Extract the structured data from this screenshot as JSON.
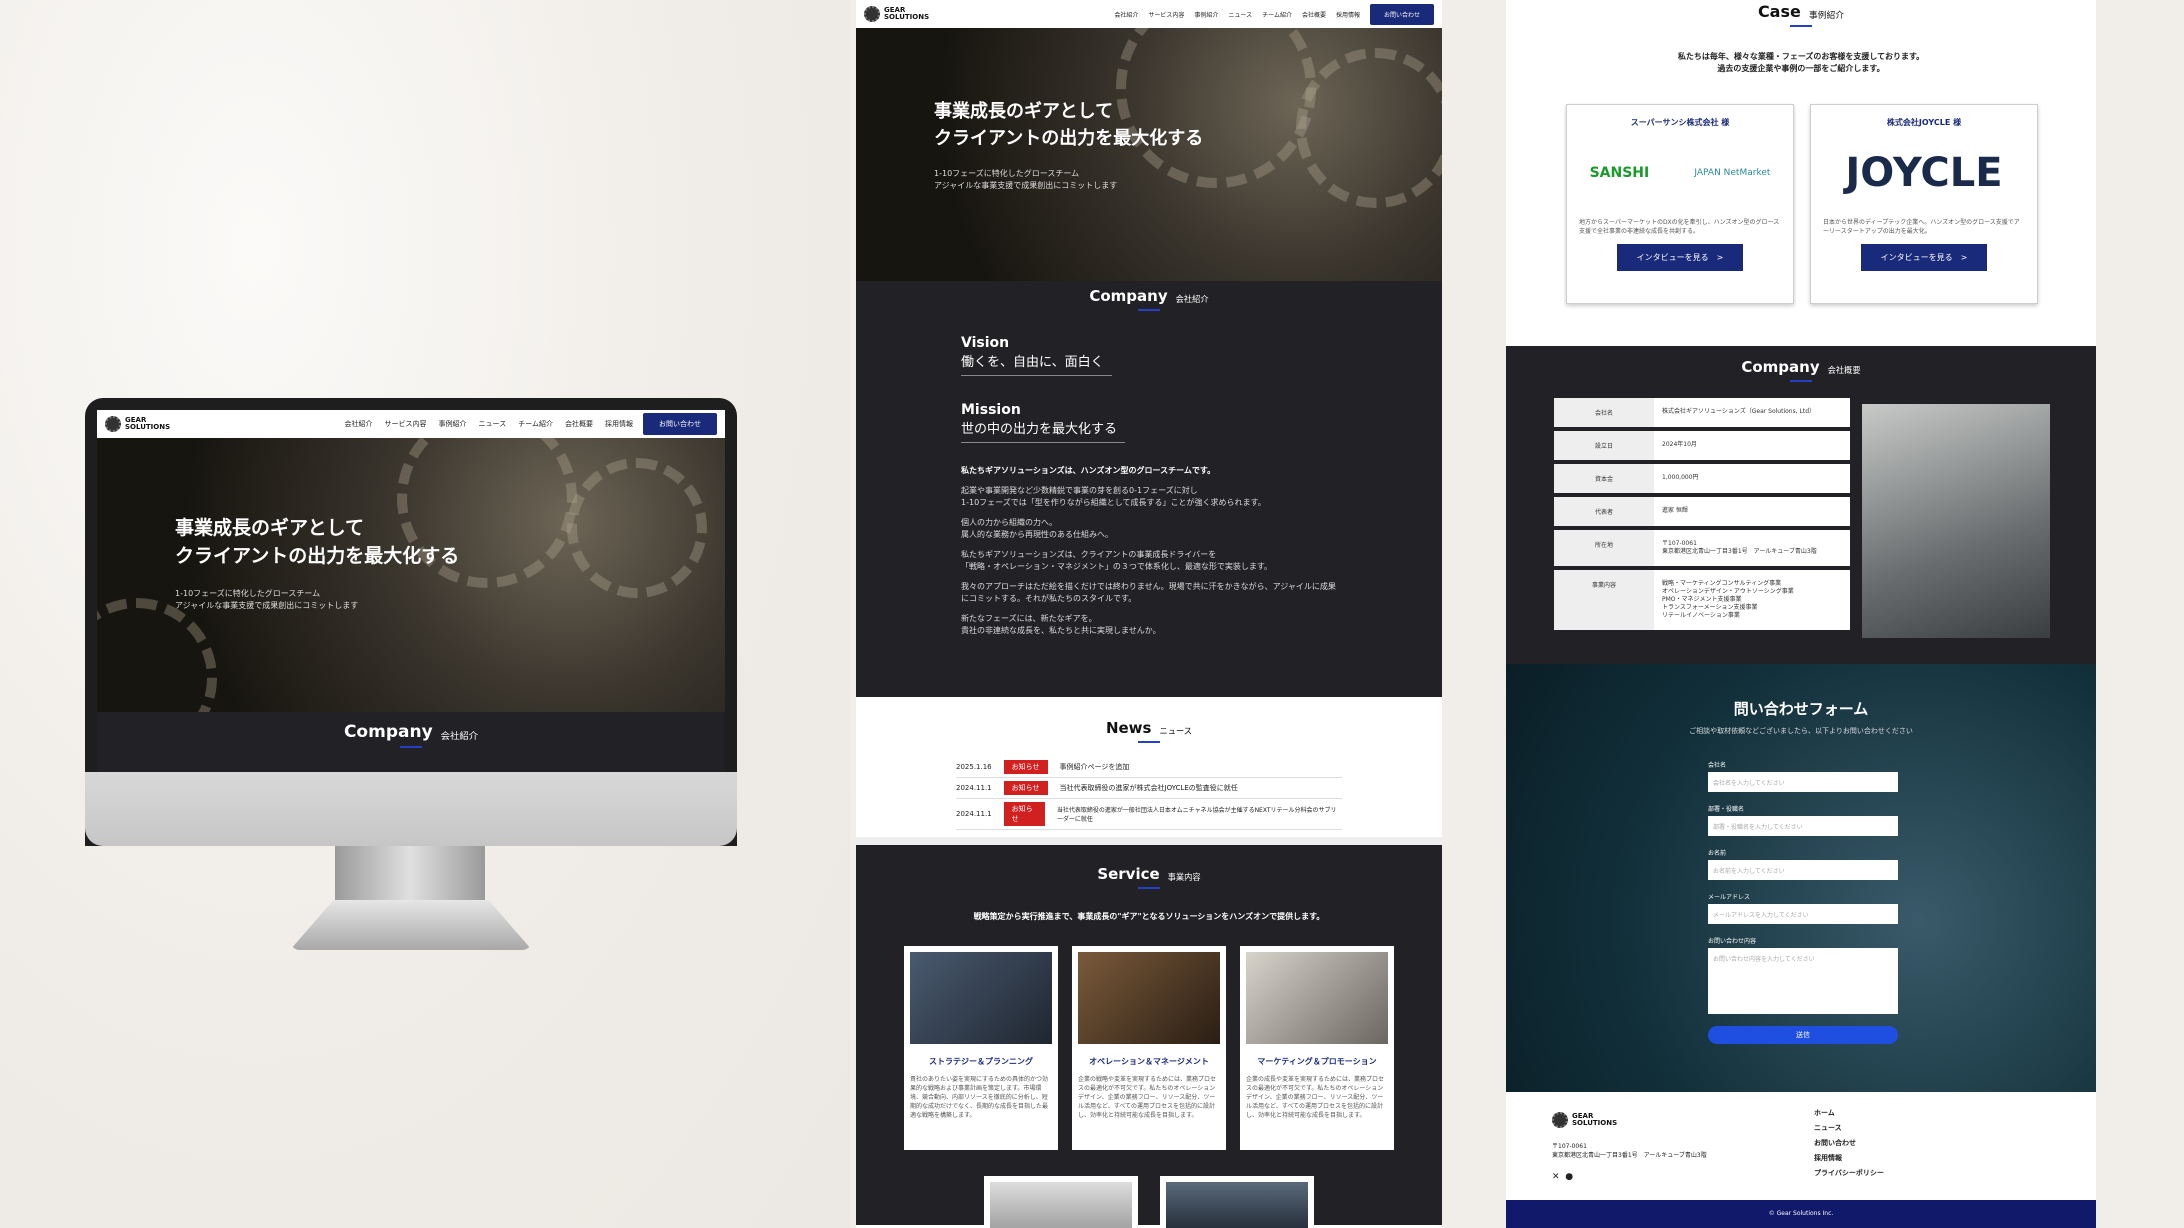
{
  "logo": {
    "line1": "GEAR",
    "line2": "SOLUTIONS"
  },
  "nav": {
    "items": [
      "会社紹介",
      "サービス内容",
      "事例紹介",
      "ニュース",
      "チーム紹介",
      "会社概要",
      "採用情報"
    ],
    "cta": "お問い合わせ"
  },
  "hero": {
    "title_line1": "事業成長のギアとして",
    "title_line2": "クライアントの出力を最大化する",
    "sub_line1": "1-10フェーズに特化したグロースチーム",
    "sub_line2": "アジャイルな事業支援で成果創出にコミットします"
  },
  "company": {
    "title": "Company",
    "jp": "会社紹介",
    "vision_label": "Vision",
    "vision": "働くを、自由に、面白く",
    "mission_label": "Mission",
    "mission": "世の中の出力を最大化する",
    "paragraphs": [
      "私たちギアソリューションズは、ハンズオン型のグロースチームです。",
      "起業や事業開発など少数精鋭で事業の芽を創る0-1フェーズに対し\n1-10フェーズでは「型を作りながら組織として成長する」ことが強く求められます。",
      "個人の力から組織の力へ。\n属人的な業務から再現性のある仕組みへ。",
      "私たちギアソリューションズは、クライアントの事業成長ドライバーを\n「戦略・オペレーション・マネジメント」の３つで体系化し、最適な形で実装します。",
      "我々のアプローチはただ絵を描くだけでは終わりません。現場で共に汗をかきながら、アジャイルに成果にコミットする。それが私たちのスタイルです。",
      "新たなフェーズには、新たなギアを。\n貴社の非連続な成長を、私たちと共に実現しませんか。"
    ]
  },
  "news": {
    "title": "News",
    "jp": "ニュース",
    "items": [
      {
        "date": "2025.1.16",
        "tag": "お知らせ",
        "text": "事例紹介ページを追加"
      },
      {
        "date": "2024.11.1",
        "tag": "お知らせ",
        "text": "当社代表取締役の進家が株式会社JOYCLEの監査役に就任"
      },
      {
        "date": "2024.11.1",
        "tag": "お知らせ",
        "text": "当社代表取締役の進家が一般社団法人日本オムニチャネル協会が主催するNEXTリテール分科会のサブリーダーに就任"
      }
    ]
  },
  "service": {
    "title": "Service",
    "jp": "事業内容",
    "lead": "戦略策定から実行推進まで、事業成長の\"ギア\"となるソリューションをハンズオンで提供します。",
    "cards": [
      {
        "title": "ストラテジー＆プランニング",
        "text": "貴社のありたい姿を実現にするための具体的かつ効果的な戦略および事業計画を策定します。市場環境、競合動向、内部リソースを徹底的に分析し、短期的な成功だけでなく、長期的な成長を目指した最適な戦略を構築します。"
      },
      {
        "title": "オペレーション＆マネージメント",
        "text": "企業の戦略や変革を実現するためには、業務プロセスの最適化が不可欠です。私たちのオペレーションデザイン、企業の業務フロー、リソース配分、ツール活用など、すべての運用プロセスを包括的に設計し、効率化と持続可能な成長を目指します。"
      },
      {
        "title": "マーケティング＆プロモーション",
        "text": "企業の成長や変革を実現するためには、業務プロセスの最適化が不可欠です。私たちのオペレーションデザイン、企業の業務フロー、リソース配分、ツール活用など、すべての運用プロセスを包括的に設計し、効率化と持続可能な成長を目指します。"
      }
    ]
  },
  "case": {
    "title": "Case",
    "jp": "事例紹介",
    "lead_line1": "私たちは毎年、様々な業種・フェーズのお客様を支援しております。",
    "lead_line2": "過去の支援企業や事例の一部をご紹介します。",
    "cards": [
      {
        "name": "スーパーサンシ株式会社 様",
        "logo1": "SANSHI",
        "logo2": "JAPAN NetMarket",
        "desc": "地方からスーパーマーケットのDXの化を牽引し、ハンズオン型のグロース支援で全社事業の非連続な成長を共創する。",
        "button": "インタビューを見る　>"
      },
      {
        "name": "株式会社JOYCLE 様",
        "logo1": "JOYCLE",
        "desc": "日本から世界のディープテック企業へ。ハンズオン型のグロース支援でアーリースタートアップの出力を最大化。",
        "button": "インタビューを見る　>"
      }
    ]
  },
  "company_profile": {
    "title": "Company",
    "jp": "会社概要",
    "rows": [
      {
        "k": "会社名",
        "v": "株式会社ギアソリューションズ（Gear Solutions, Ltd）"
      },
      {
        "k": "設立日",
        "v": "2024年10月"
      },
      {
        "k": "資本金",
        "v": "1,000,000円"
      },
      {
        "k": "代表者",
        "v": "進家 恒輝"
      },
      {
        "k": "所在地",
        "v": "〒107-0061\n東京都港区北青山一丁目3番1号　アールキューブ青山3階"
      },
      {
        "k": "事業内容",
        "v": "戦略・マーケティングコンサルティング事業\nオペレーションデザイン・アウトソーシング事業\nPMO・マネジメント支援事業\nトランスフォーメーション支援事業\nリテールイノベーション事業"
      }
    ]
  },
  "contact": {
    "title": "問い合わせフォーム",
    "lead": "ご相談や取材依頼などございましたら、以下よりお問い合わせください",
    "fields": [
      {
        "label": "会社名",
        "placeholder": "会社名を入力してください"
      },
      {
        "label": "部署・役職名",
        "placeholder": "部署・役職名を入力してください"
      },
      {
        "label": "お名前",
        "placeholder": "お名前を入力してください"
      },
      {
        "label": "メールアドレス",
        "placeholder": "メールアドレスを入力してください"
      },
      {
        "label": "お問い合わせ内容",
        "placeholder": "お問い合わせ内容を入力してください"
      }
    ],
    "submit": "送信"
  },
  "footer": {
    "address_line1": "〒107-0061",
    "address_line2": "東京都港区北青山一丁目3番1号　アールキューブ青山3階",
    "links": [
      "ホーム",
      "ニュース",
      "お問い合わせ",
      "採用情報",
      "プライバシーポリシー"
    ],
    "copyright": "© Gear Solutions Inc."
  }
}
